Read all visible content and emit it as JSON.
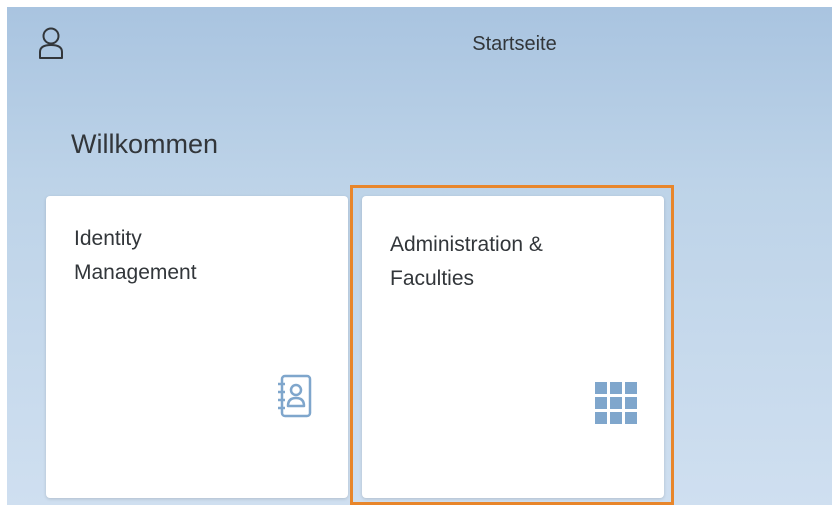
{
  "header": {
    "title": "Startseite",
    "user_icon": "user-icon"
  },
  "page": {
    "welcome": "Willkommen"
  },
  "tiles": [
    {
      "title_line1": "Identity",
      "title_line2": "Management",
      "icon": "address-book-icon"
    },
    {
      "title_line1": "Administration &",
      "title_line2": "Faculties",
      "icon": "grid-icon",
      "focused": true
    }
  ],
  "colors": {
    "background_top": "#a9c4e0",
    "background_bottom": "#cfdff0",
    "text": "#32363a",
    "icon": "#7fa6cc",
    "focus": "#e8862b"
  }
}
